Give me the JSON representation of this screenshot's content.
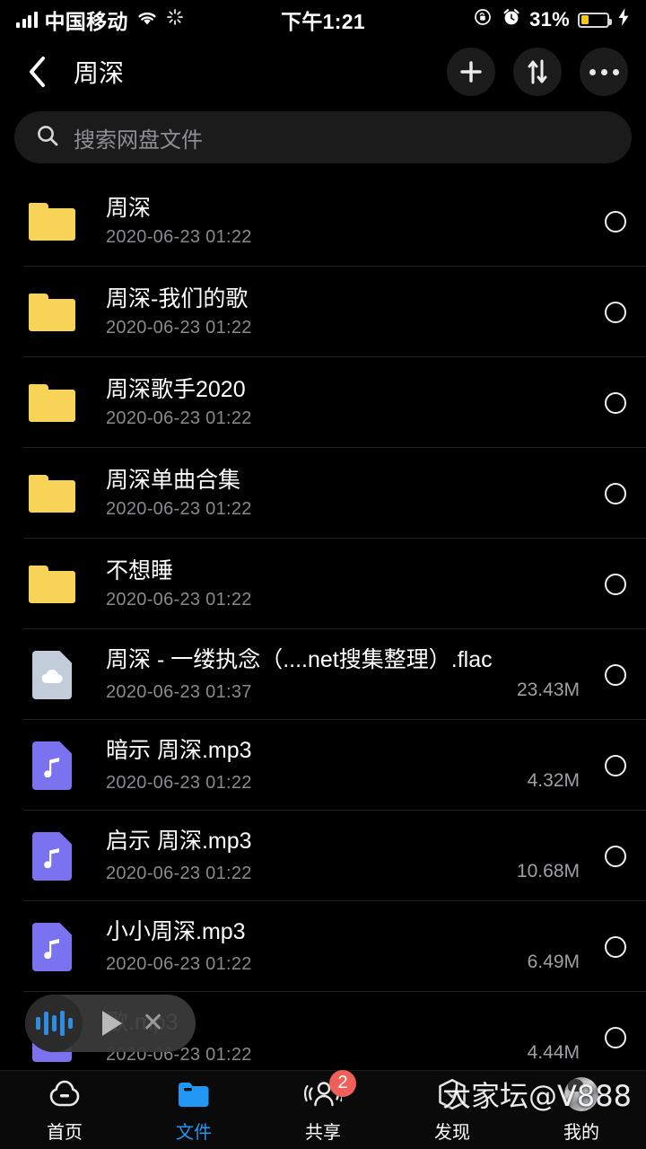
{
  "status_bar": {
    "carrier": "中国移动",
    "time": "下午1:21",
    "battery_percent": "31%",
    "icons": [
      "signal-bars-icon",
      "wifi-icon",
      "sync-spinner-icon",
      "rotation-lock-icon",
      "alarm-clock-icon",
      "battery-icon",
      "charging-bolt-icon"
    ],
    "battery_color": "#f5c518"
  },
  "header": {
    "title": "周深",
    "back_label": "‹",
    "actions": [
      {
        "name": "add-button",
        "glyph": "+"
      },
      {
        "name": "sort-button",
        "glyph": "⇅"
      },
      {
        "name": "more-button",
        "glyph": "•••"
      }
    ]
  },
  "search": {
    "placeholder": "搜索网盘文件"
  },
  "files": [
    {
      "name": "周深",
      "date": "2020-06-23 01:22",
      "size": "",
      "type": "folder"
    },
    {
      "name": "周深-我们的歌",
      "date": "2020-06-23 01:22",
      "size": "",
      "type": "folder"
    },
    {
      "name": "周深歌手2020",
      "date": "2020-06-23 01:22",
      "size": "",
      "type": "folder"
    },
    {
      "name": "周深单曲合集",
      "date": "2020-06-23 01:22",
      "size": "",
      "type": "folder"
    },
    {
      "name": "不想睡",
      "date": "2020-06-23 01:22",
      "size": "",
      "type": "folder"
    },
    {
      "name": "周深 - 一缕执念（....net搜集整理）.flac",
      "date": "2020-06-23 01:37",
      "size": "23.43M",
      "type": "cloud"
    },
    {
      "name": "暗示 周深.mp3",
      "date": "2020-06-23 01:22",
      "size": "4.32M",
      "type": "music"
    },
    {
      "name": "启示 周深.mp3",
      "date": "2020-06-23 01:22",
      "size": "10.68M",
      "type": "music"
    },
    {
      "name": "小小周深.mp3",
      "date": "2020-06-23 01:22",
      "size": "6.49M",
      "type": "music"
    },
    {
      "name": "歌.mp3",
      "date": "2020-06-23 01:22",
      "size": "4.44M",
      "type": "music"
    }
  ],
  "mini_player": {
    "waveform_icon": "audio-waveform-icon",
    "play_icon": "play-icon",
    "close_icon": "close-icon",
    "accent": "#2f8de0"
  },
  "tabbar": {
    "active_color": "#2196f3",
    "items": [
      {
        "label": "首页",
        "icon": "home-cloud-icon",
        "badge": "",
        "active": false
      },
      {
        "label": "文件",
        "icon": "folder-icon",
        "badge": "",
        "active": true
      },
      {
        "label": "共享",
        "icon": "people-icon",
        "badge": "2",
        "active": false
      },
      {
        "label": "发现",
        "icon": "compass-icon",
        "badge": "",
        "active": false
      },
      {
        "label": "我的",
        "icon": "avatar-icon",
        "badge": "",
        "active": false
      }
    ]
  },
  "watermark": {
    "text": "大家坛@V888"
  }
}
